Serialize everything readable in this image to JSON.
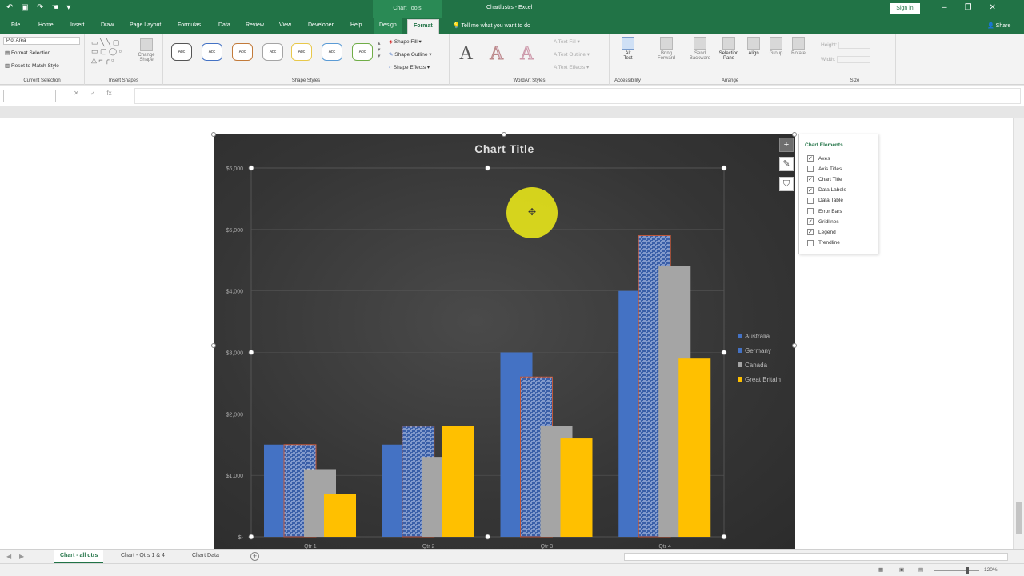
{
  "titlebar": {
    "context_label": "Chart Tools",
    "document_title": "Chartlustrs - Excel",
    "sign_in": "Sign in"
  },
  "tabs": [
    "File",
    "Home",
    "Insert",
    "Draw",
    "Page Layout",
    "Formulas",
    "Data",
    "Review",
    "View",
    "Developer",
    "Help",
    "Design",
    "Format"
  ],
  "active_tab": "Format",
  "tell_me": "Tell me what you want to do",
  "share": "Share",
  "ribbon": {
    "current_selection": {
      "dropdown_value": "Plot Area",
      "format_selection": "Format Selection",
      "reset_style": "Reset to Match Style",
      "label": "Current Selection"
    },
    "insert_shapes": {
      "change_shape": "Change Shape",
      "label": "Insert Shapes"
    },
    "shape_styles": {
      "styles": [
        "Abc",
        "Abc",
        "Abc",
        "Abc",
        "Abc",
        "Abc",
        "Abc"
      ],
      "shape_fill": "Shape Fill",
      "shape_outline": "Shape Outline",
      "shape_effects": "Shape Effects",
      "label": "Shape Styles"
    },
    "wordart": {
      "letters": [
        "A",
        "A",
        "A"
      ],
      "text_fill": "Text Fill",
      "text_outline": "Text Outline",
      "text_effects": "Text Effects",
      "label": "WordArt Styles"
    },
    "accessibility": {
      "alt_text_1": "Alt",
      "alt_text_2": "Text",
      "label": "Accessibility"
    },
    "arrange": {
      "bring_forward": "Bring Forward",
      "send_backward": "Send Backward",
      "selection_pane": "Selection Pane",
      "align": "Align",
      "group": "Group",
      "rotate": "Rotate",
      "label": "Arrange"
    },
    "size": {
      "height_label": "Height:",
      "width_label": "Width:",
      "label": "Size"
    }
  },
  "formula_bar": {
    "fx": "fx"
  },
  "chart_data": {
    "type": "bar",
    "title": "Chart Title",
    "categories": [
      "Qtr 1",
      "Qtr 2",
      "Qtr 3",
      "Qtr 4"
    ],
    "series": [
      {
        "name": "Australia",
        "values": [
          1500,
          1500,
          3000,
          4000
        ],
        "color": "#4472c4"
      },
      {
        "name": "Germany",
        "values": [
          1500,
          1800,
          2600,
          4900
        ],
        "color": "#4472c4"
      },
      {
        "name": "Canada",
        "values": [
          1100,
          1300,
          1800,
          4400
        ],
        "color": "#a5a5a5"
      },
      {
        "name": "Great Britain",
        "values": [
          700,
          1800,
          1600,
          2900
        ],
        "color": "#ffc000"
      }
    ],
    "yticks": [
      "$6,000",
      "$5,000",
      "$4,000",
      "$3,000",
      "$2,000",
      "$1,000",
      "$-"
    ],
    "ylim": [
      0,
      6000
    ],
    "legend_position": "right",
    "gridlines": true
  },
  "chart_elements": {
    "title": "Chart Elements",
    "items": [
      {
        "label": "Axes",
        "checked": true
      },
      {
        "label": "Axis Titles",
        "checked": false
      },
      {
        "label": "Chart Title",
        "checked": true
      },
      {
        "label": "Data Labels",
        "checked": true
      },
      {
        "label": "Data Table",
        "checked": false
      },
      {
        "label": "Error Bars",
        "checked": false
      },
      {
        "label": "Gridlines",
        "checked": true
      },
      {
        "label": "Legend",
        "checked": true
      },
      {
        "label": "Trendline",
        "checked": false
      }
    ]
  },
  "sheet_tabs": [
    "Chart - all qtrs",
    "Chart - Qtrs 1 & 4",
    "Chart Data"
  ],
  "active_sheet": "Chart - all qtrs",
  "status": {
    "zoom": "120%"
  }
}
